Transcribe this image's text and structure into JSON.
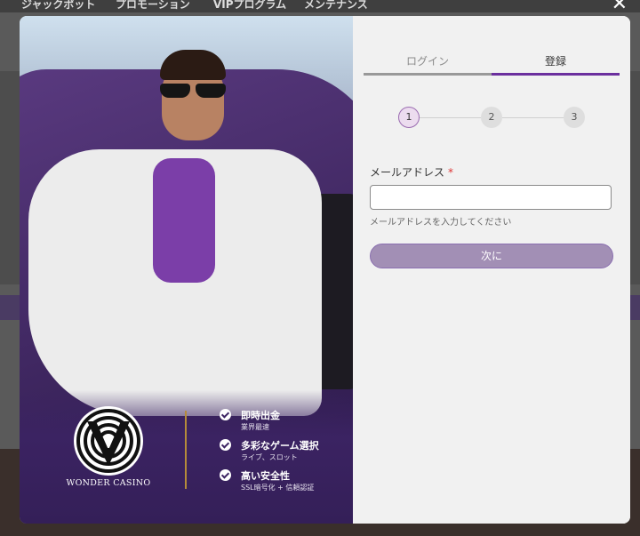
{
  "background": {
    "nav": [
      "ジャックポット",
      "プロモーション",
      "VIPプログラム",
      "メンテナンス"
    ]
  },
  "modal": {
    "close_icon": "close-icon",
    "brand": {
      "name": "WONDER CASINO"
    },
    "features": [
      {
        "title": "即時出金",
        "subtitle": "業界最速"
      },
      {
        "title": "多彩なゲーム選択",
        "subtitle": "ライブ、スロット"
      },
      {
        "title": "高い安全性",
        "subtitle": "SSL暗号化 + 信頼認証"
      }
    ],
    "tabs": {
      "login": "ログイン",
      "register": "登録",
      "active": "register"
    },
    "steps": [
      "1",
      "2",
      "3"
    ],
    "current_step": 1,
    "form": {
      "email_label": "メールアドレス",
      "required_mark": "*",
      "email_value": "",
      "hint": "メールアドレスを入力してください",
      "next_label": "次に"
    },
    "colors": {
      "accent": "#6b2f9e",
      "button": "#a28fb5"
    }
  }
}
